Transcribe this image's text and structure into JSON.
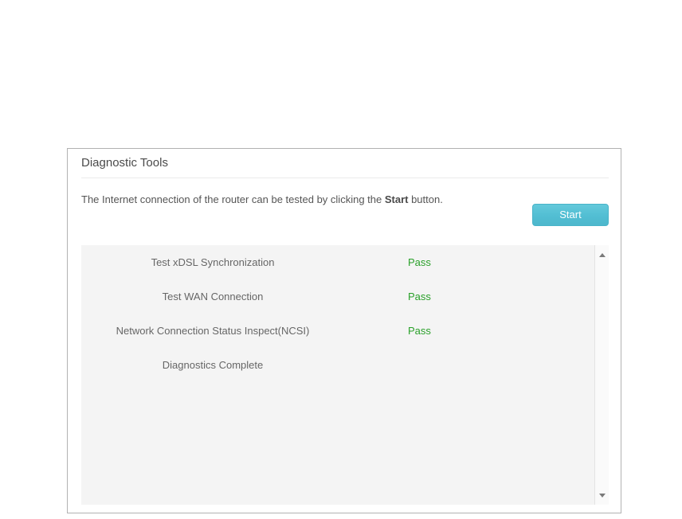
{
  "panel": {
    "title": "Diagnostic Tools",
    "description": {
      "prefix": "The Internet connection of the router can be tested by clicking the ",
      "bold_word": "Start",
      "suffix": " button."
    },
    "start_button": {
      "label": "Start"
    }
  },
  "results": {
    "rows": [
      {
        "label": "Test xDSL Synchronization",
        "status": "Pass"
      },
      {
        "label": "Test WAN Connection",
        "status": "Pass"
      },
      {
        "label": "Network Connection Status Inspect(NCSI)",
        "status": "Pass"
      },
      {
        "label": "Diagnostics Complete",
        "status": ""
      }
    ]
  },
  "icons": {
    "scroll_up": "scroll-up-arrow",
    "scroll_down": "scroll-down-arrow"
  },
  "colors": {
    "panel_border": "#b2b2b2",
    "results_background": "#f4f4f4",
    "body_text": "#555555",
    "pass_green": "#2aa02a",
    "button_teal_top": "#63c9db",
    "button_teal_bottom": "#4db7cc"
  }
}
